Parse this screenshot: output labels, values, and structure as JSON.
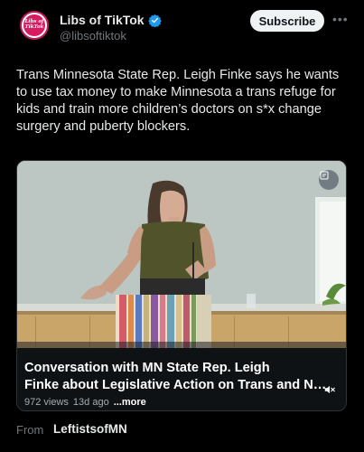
{
  "author": {
    "name": "Libs of TikTok",
    "handle": "@libsoftiktok",
    "avatar_text_line1": "Libs of",
    "avatar_text_line2": "TikTok",
    "verified": true
  },
  "header": {
    "subscribe_label": "Subscribe",
    "more_icon": "ellipsis-icon"
  },
  "post": {
    "text": "Trans Minnesota State Rep. Leigh Finke says he wants to use tax money to make Minnesota a trans refuge for kids and train more children’s doctors on s*x change surgery and puberty blockers."
  },
  "video": {
    "title_line1": "Conversation with MN State Rep. Leigh",
    "title_line2": "Finke about Legislative Action on Trans and No...",
    "views": "972 views",
    "age": "13d ago",
    "more_label": "...more",
    "overlay_icon": "settings-icon",
    "sound_icon": "mute-icon"
  },
  "footer": {
    "from_label": "From",
    "source_name": "LeftistsofMN"
  },
  "colors": {
    "background": "#000000",
    "text": "#e7e9ea",
    "muted": "#71767b",
    "verified": "#1d9bf0",
    "avatar_ring": "#c2185b"
  }
}
